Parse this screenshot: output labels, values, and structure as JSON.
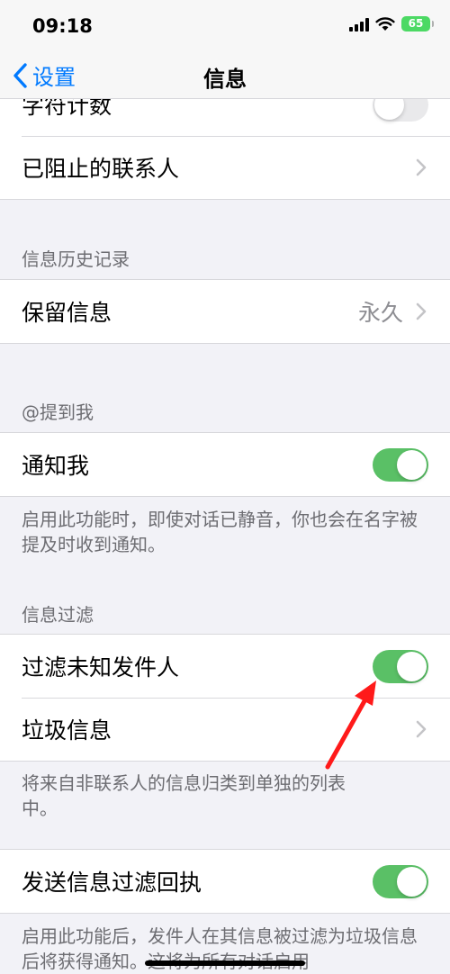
{
  "status_bar": {
    "time": "09:18",
    "battery": "65"
  },
  "nav": {
    "back_label": "设置",
    "title": "信息"
  },
  "rows": {
    "character_count": "字符计数",
    "blocked_contacts": "已阻止的联系人",
    "keep_messages": {
      "label": "保留信息",
      "value": "永久"
    },
    "notify_me": "通知我",
    "filter_unknown": "过滤未知发件人",
    "junk": "垃圾信息",
    "send_filter_receipt": "发送信息过滤回执"
  },
  "toggles": {
    "character_count": false,
    "notify_me": true,
    "filter_unknown": true,
    "send_filter_receipt": true
  },
  "sections": {
    "history_header": "信息历史记录",
    "mentions_header": "@提到我",
    "filter_header": "信息过滤"
  },
  "footers": {
    "mentions": "启用此功能时，即使对话已静音，你也会在名字被提及时收到通知。",
    "filter": "将来自非联系人的信息归类到单独的列表中。",
    "receipt": "启用此功能后，发件人在其信息被过滤为垃圾信息后将获得通知。这将为所有对话启用"
  },
  "colors": {
    "accent": "#007aff",
    "toggle_on": "#5ac066",
    "annotation_arrow": "#ff1a1a"
  }
}
